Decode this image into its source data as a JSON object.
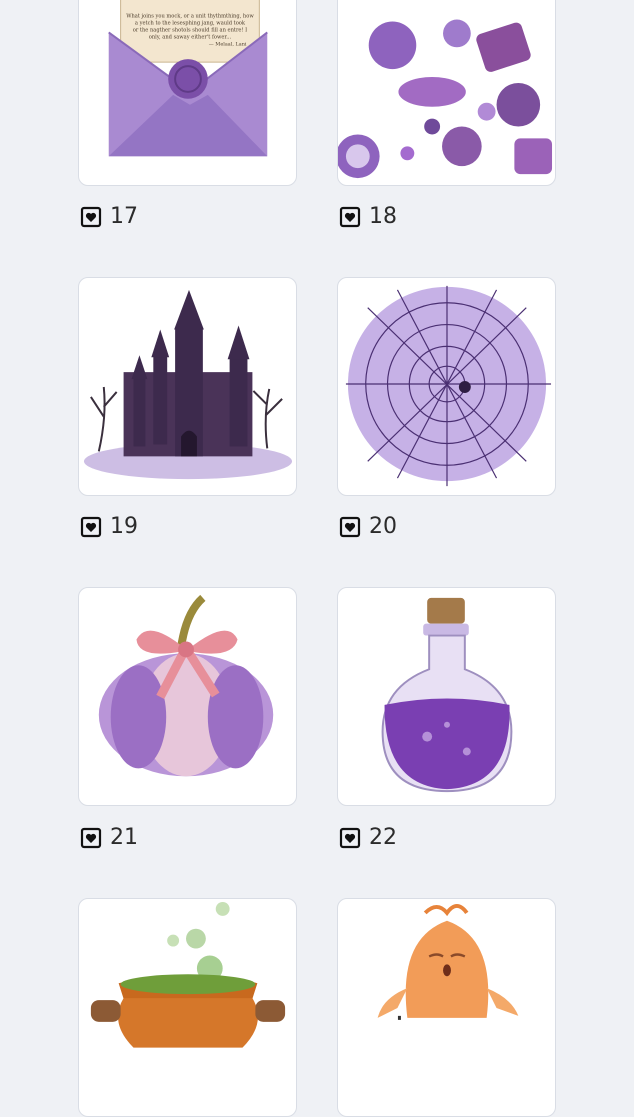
{
  "items": [
    {
      "number": "17",
      "illustration": "wax-sealed-letter",
      "letter_lines": [
        "What joins you mock, or a unit thythmthing, how",
        "a yetch to the lesesphing jang, wauld took",
        "or the nagther shotols should fill an entre! I",
        "only, and saway either't fower...",
        "— Melaal, Lani"
      ]
    },
    {
      "number": "18",
      "illustration": "candy-pattern"
    },
    {
      "number": "19",
      "illustration": "haunted-castle"
    },
    {
      "number": "20",
      "illustration": "spider-web"
    },
    {
      "number": "21",
      "illustration": "pumpkin-with-bow"
    },
    {
      "number": "22",
      "illustration": "potion-bottle"
    },
    {
      "number": "",
      "illustration": "bubbling-cauldron"
    },
    {
      "number": "",
      "illustration": "orange-ghost"
    }
  ],
  "icons": {
    "like": "heart-square-icon"
  },
  "colors": {
    "background": "#eff1f5",
    "accent_purple": "#7b4fa8",
    "text": "#2b2b2b"
  }
}
